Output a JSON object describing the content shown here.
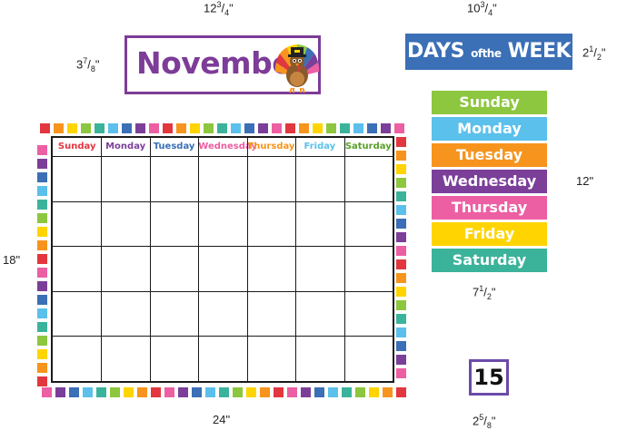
{
  "dimensions": {
    "title_width": {
      "whole": "12",
      "num": "3",
      "den": "4",
      "unit": "\""
    },
    "title_height": {
      "whole": "3",
      "num": "7",
      "den": "8",
      "unit": "\""
    },
    "banner_width": {
      "whole": "10",
      "num": "3",
      "den": "4",
      "unit": "\""
    },
    "banner_height": {
      "whole": "2",
      "num": "1",
      "den": "2",
      "unit": "\""
    },
    "strips_height": "12\"",
    "strips_width": {
      "whole": "7",
      "num": "1",
      "den": "2",
      "unit": "\""
    },
    "calendar_height": "18\"",
    "calendar_width": "24\"",
    "card_width": {
      "whole": "2",
      "num": "5",
      "den": "8",
      "unit": "\""
    }
  },
  "month_card": {
    "label": "November",
    "color": "#7d3c98"
  },
  "banner": {
    "days": "DAYS",
    "of": "of",
    "the": "the",
    "week": "WEEK",
    "color": "#3b6fb6"
  },
  "day_strips": [
    {
      "label": "Sunday",
      "color": "#8dc63f"
    },
    {
      "label": "Monday",
      "color": "#5bc0eb"
    },
    {
      "label": "Tuesday",
      "color": "#f7941d"
    },
    {
      "label": "Wednesday",
      "color": "#7b3f99"
    },
    {
      "label": "Thursday",
      "color": "#ec5fa3"
    },
    {
      "label": "Friday",
      "color": "#ffd400"
    },
    {
      "label": "Saturday",
      "color": "#3bb39b"
    }
  ],
  "calendar_headers": [
    {
      "label": "Sunday",
      "color": "#e2373f"
    },
    {
      "label": "Monday",
      "color": "#7b3f99"
    },
    {
      "label": "Tuesday",
      "color": "#3b6fb6"
    },
    {
      "label": "Wednesday",
      "color": "#ec5fa3"
    },
    {
      "label": "Thursday",
      "color": "#f7941d"
    },
    {
      "label": "Friday",
      "color": "#5bc0eb"
    },
    {
      "label": "Saturday",
      "color": "#5aa02c"
    }
  ],
  "border_colors": [
    "#e2373f",
    "#f7941d",
    "#ffd400",
    "#8dc63f",
    "#3bb39b",
    "#5bc0eb",
    "#3b6fb6",
    "#7b3f99",
    "#ec5fa3"
  ],
  "number_card": {
    "value": "15",
    "color": "#6b4aa8"
  }
}
